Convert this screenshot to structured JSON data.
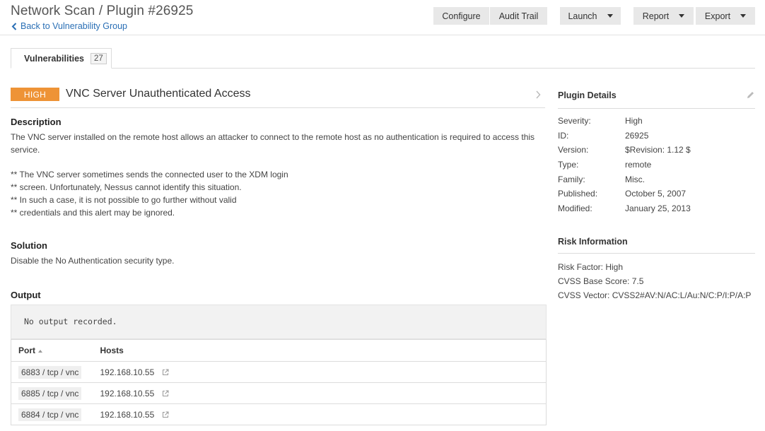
{
  "header": {
    "title": "Network Scan / Plugin #26925",
    "back_link": "Back to Vulnerability Group",
    "buttons": {
      "configure": "Configure",
      "audit_trail": "Audit Trail",
      "launch": "Launch",
      "report": "Report",
      "export": "Export"
    }
  },
  "tabs": [
    {
      "label": "Vulnerabilities",
      "count": "27"
    }
  ],
  "vulnerability": {
    "severity": "HIGH",
    "severity_color": "#ee9336",
    "title": "VNC Server Unauthenticated Access",
    "description_heading": "Description",
    "description": "The VNC server installed on the remote host allows an attacker to connect to the remote host as no authentication is required to access this service.",
    "description_notes": [
      "** The VNC server sometimes sends the connected user to the XDM login",
      "** screen. Unfortunately, Nessus cannot identify this situation.",
      "** In such a case, it is not possible to go further without valid",
      "** credentials and this alert may be ignored."
    ],
    "solution_heading": "Solution",
    "solution": "Disable the No Authentication security type.",
    "output_heading": "Output",
    "output_text": "No output recorded.",
    "table": {
      "columns": [
        "Port",
        "Hosts"
      ],
      "rows": [
        {
          "port": "6883 / tcp / vnc",
          "host": "192.168.10.55"
        },
        {
          "port": "6885 / tcp / vnc",
          "host": "192.168.10.55"
        },
        {
          "port": "6884 / tcp / vnc",
          "host": "192.168.10.55"
        }
      ]
    }
  },
  "plugin_details": {
    "heading": "Plugin Details",
    "rows": [
      {
        "label": "Severity:",
        "value": "High"
      },
      {
        "label": "ID:",
        "value": "26925"
      },
      {
        "label": "Version:",
        "value": "$Revision: 1.12 $"
      },
      {
        "label": "Type:",
        "value": "remote"
      },
      {
        "label": "Family:",
        "value": "Misc."
      },
      {
        "label": "Published:",
        "value": "October 5, 2007"
      },
      {
        "label": "Modified:",
        "value": "January 25, 2013"
      }
    ]
  },
  "risk_information": {
    "heading": "Risk Information",
    "lines": [
      "Risk Factor: High",
      "CVSS Base Score: 7.5",
      "CVSS Vector: CVSS2#AV:N/AC:L/Au:N/C:P/I:P/A:P"
    ]
  },
  "icons": {
    "back": "chevron-left-icon",
    "next": "chevron-right-icon",
    "edit": "pencil-icon",
    "external": "external-link-icon",
    "dropdown": "caret-down-icon"
  },
  "colors": {
    "link": "#2a6fb5",
    "high_severity": "#ee9336"
  }
}
